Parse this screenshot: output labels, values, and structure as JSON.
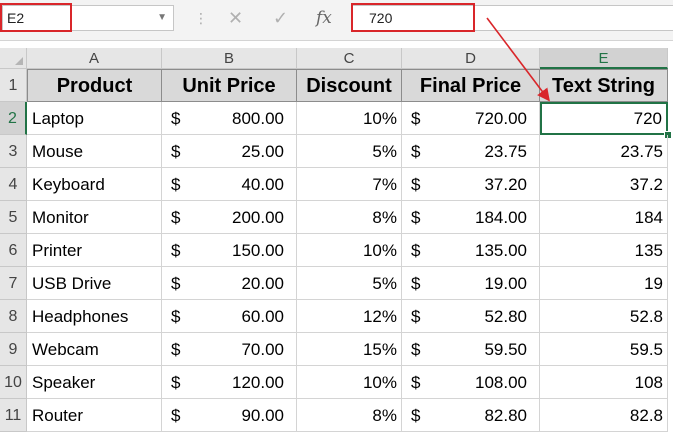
{
  "formula_bar": {
    "name_box": "E2",
    "formula_value": "720",
    "fx_label": "fx"
  },
  "selection_cell": "E2",
  "columns": [
    "A",
    "B",
    "C",
    "D",
    "E"
  ],
  "rows": [
    "1",
    "2",
    "3",
    "4",
    "5",
    "6",
    "7",
    "8",
    "9",
    "10",
    "11"
  ],
  "headers": [
    "Product",
    "Unit Price",
    "Discount",
    "Final Price",
    "Text String"
  ],
  "currency_symbol": "$",
  "data_rows": [
    {
      "product": "Laptop",
      "unit_price": "800.00",
      "discount": "10%",
      "final_price": "720.00",
      "text_string": "720"
    },
    {
      "product": "Mouse",
      "unit_price": "25.00",
      "discount": "5%",
      "final_price": "23.75",
      "text_string": "23.75"
    },
    {
      "product": "Keyboard",
      "unit_price": "40.00",
      "discount": "7%",
      "final_price": "37.20",
      "text_string": "37.2"
    },
    {
      "product": "Monitor",
      "unit_price": "200.00",
      "discount": "8%",
      "final_price": "184.00",
      "text_string": "184"
    },
    {
      "product": "Printer",
      "unit_price": "150.00",
      "discount": "10%",
      "final_price": "135.00",
      "text_string": "135"
    },
    {
      "product": "USB Drive",
      "unit_price": "20.00",
      "discount": "5%",
      "final_price": "19.00",
      "text_string": "19"
    },
    {
      "product": "Headphones",
      "unit_price": "60.00",
      "discount": "12%",
      "final_price": "52.80",
      "text_string": "52.8"
    },
    {
      "product": "Webcam",
      "unit_price": "70.00",
      "discount": "15%",
      "final_price": "59.50",
      "text_string": "59.5"
    },
    {
      "product": "Speaker",
      "unit_price": "120.00",
      "discount": "10%",
      "final_price": "108.00",
      "text_string": "108"
    },
    {
      "product": "Router",
      "unit_price": "90.00",
      "discount": "8%",
      "final_price": "82.80",
      "text_string": "82.8"
    }
  ],
  "colors": {
    "highlight_red": "#d9262a",
    "selection_green": "#217346",
    "header_fill": "#d9d9d9"
  },
  "icons": [
    "cancel-icon",
    "enter-check-icon",
    "function-icon",
    "dropdown-chevron-icon"
  ]
}
